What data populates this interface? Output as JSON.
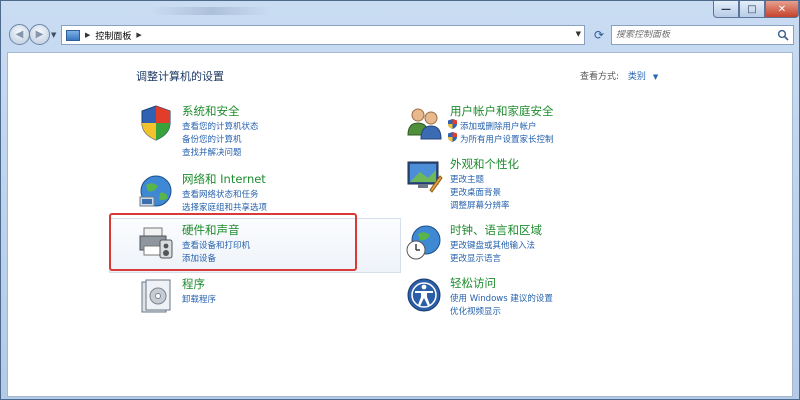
{
  "window": {
    "min_label": "—",
    "max_label": "□",
    "close_label": "✕"
  },
  "address": {
    "path": "控制面板",
    "search_placeholder": "搜索控制面板"
  },
  "page": {
    "title": "调整计算机的设置",
    "view_by_label": "查看方式:",
    "view_by_value": "类别"
  },
  "categories": [
    {
      "title": "系统和安全",
      "icon": "system-security-icon",
      "links": [
        "查看您的计算机状态",
        "备份您的计算机",
        "查找并解决问题"
      ]
    },
    {
      "title": "网络和 Internet",
      "icon": "network-internet-icon",
      "links": [
        "查看网络状态和任务",
        "选择家庭组和共享选项"
      ]
    },
    {
      "title": "硬件和声音",
      "icon": "hardware-sound-icon",
      "links": [
        "查看设备和打印机",
        "添加设备"
      ]
    },
    {
      "title": "程序",
      "icon": "programs-icon",
      "links": [
        "卸载程序"
      ]
    },
    {
      "title": "用户帐户和家庭安全",
      "icon": "user-accounts-icon",
      "links": [
        "添加或删除用户帐户",
        "为所有用户设置家长控制"
      ]
    },
    {
      "title": "外观和个性化",
      "icon": "appearance-icon",
      "links": [
        "更改主题",
        "更改桌面背景",
        "调整屏幕分辨率"
      ]
    },
    {
      "title": "时钟、语言和区域",
      "icon": "clock-language-icon",
      "links": [
        "更改键盘或其他输入法",
        "更改显示语言"
      ]
    },
    {
      "title": "轻松访问",
      "icon": "ease-of-access-icon",
      "links": [
        "使用 Windows 建议的设置",
        "优化视频显示"
      ]
    }
  ],
  "colors": {
    "category_title": "#1e8c2e",
    "link": "#2662ad",
    "highlight": "#d83a3a"
  }
}
